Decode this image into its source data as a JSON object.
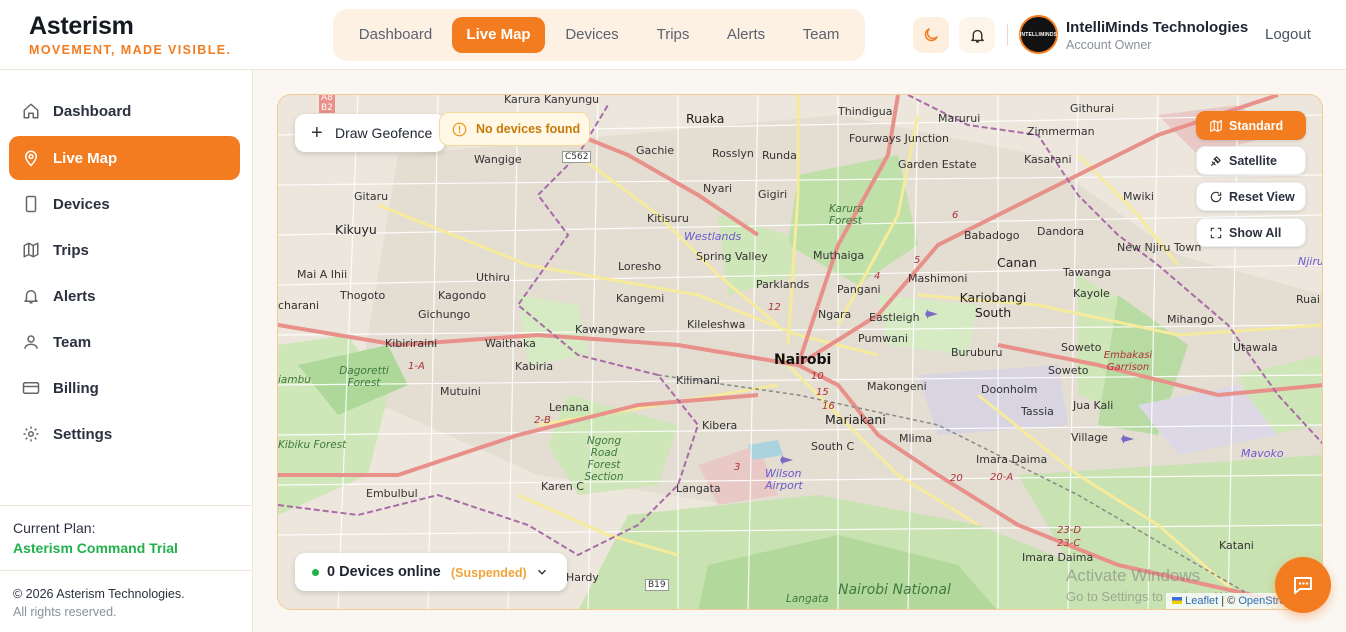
{
  "brand": {
    "name": "Asterism",
    "tagline": "MOVEMENT, MADE VISIBLE."
  },
  "topnav": {
    "tabs": [
      "Dashboard",
      "Live Map",
      "Devices",
      "Trips",
      "Alerts",
      "Team"
    ],
    "active": "Live Map"
  },
  "header": {
    "theme_icon": "moon-icon",
    "notification_icon": "bell-icon",
    "account": {
      "avatar_text": "INTELLIMINDS",
      "name": "IntelliMinds Technologies",
      "role": "Account Owner"
    },
    "logout_label": "Logout"
  },
  "sidebar": {
    "items": [
      {
        "label": "Dashboard",
        "icon": "home-icon"
      },
      {
        "label": "Live Map",
        "icon": "map-pin-icon"
      },
      {
        "label": "Devices",
        "icon": "device-icon"
      },
      {
        "label": "Trips",
        "icon": "map-icon"
      },
      {
        "label": "Alerts",
        "icon": "bell-icon"
      },
      {
        "label": "Team",
        "icon": "users-icon"
      },
      {
        "label": "Billing",
        "icon": "credit-card-icon"
      },
      {
        "label": "Settings",
        "icon": "gear-icon"
      }
    ],
    "active": "Live Map",
    "plan_label": "Current Plan:",
    "plan_value": "Asterism Command Trial",
    "copyright": "© 2026 Asterism Technologies.",
    "rights": "All rights reserved."
  },
  "map": {
    "geofence_label": "Draw Geofence",
    "no_devices": "No devices found",
    "view_buttons": [
      "Standard",
      "Satellite",
      "Reset View",
      "Show All"
    ],
    "active_view": "Standard",
    "devices_online": "0 Devices online",
    "devices_status": "(Suspended)",
    "attribution_leaflet": "Leaflet",
    "attribution_sep": " | © ",
    "attribution_osm": "OpenStreetMap",
    "watermark_line1": "Activate Windows",
    "watermark_line2": "Go to Settings to activate Windows.",
    "place_labels": {
      "ruaka": "Ruaka",
      "karura_kanyungu": "Karura Kanyungu",
      "wangige": "Wangige",
      "gachie": "Gachie",
      "rosslyn": "Rosslyn",
      "runda": "Runda",
      "nyari": "Nyari",
      "gigiri": "Gigiri",
      "thindigua": "Thindigua",
      "fourways": "Fourways Junction",
      "marurui": "Marurui",
      "githurai": "Githurai",
      "zimmerman": "Zimmerman",
      "garden_estate": "Garden Estate",
      "kasarani": "Kasarani",
      "gitaru": "Gitaru",
      "kitisuru": "Kitisuru",
      "karura_forest": "Karura Forest",
      "mwiki": "Mwiki",
      "kikuyu": "Kikuyu",
      "westlands": "Westlands",
      "spring_valley": "Spring Valley",
      "muthaiga": "Muthaiga",
      "babadogo": "Babadogo",
      "dandora": "Dandora",
      "new_njiru": "New Njiru Town",
      "mai_a_ihii": "Mai A Ihii",
      "uthiru": "Uthiru",
      "loresho": "Loresho",
      "mashimoni": "Mashimoni",
      "canan": "Canan",
      "tawanga": "Tawanga",
      "thogoto": "Thogoto",
      "kagondo": "Kagondo",
      "kangemi": "Kangemi",
      "parklands": "Parklands",
      "pangani": "Pangani",
      "kariobangi": "Kariobangi South",
      "kayole": "Kayole",
      "gichungo": "Gichungo",
      "kawangware": "Kawangware",
      "kileleshwa": "Kileleshwa",
      "ngara": "Ngara",
      "eastleigh": "Eastleigh",
      "mihango": "Mihango",
      "kibiriraini": "Kibiriraini",
      "waithaka": "Waithaka",
      "pumwani": "Pumwani",
      "soweto1": "Soweto",
      "utawala": "Utawala",
      "dagoretti": "Dagoretti Forest",
      "kabiria": "Kabiria",
      "nairobi": "Nairobi",
      "buruburu": "Buruburu",
      "embakasi": "Embakasi Garrison",
      "soweto2": "Soweto",
      "kilimani": "Kilimani",
      "makongeni": "Makongeni",
      "doonholm": "Doonholm",
      "mutuini": "Mutuini",
      "lenana": "Lenana",
      "mariakani": "Mariakani",
      "tassia": "Tassia",
      "jua_kali": "Jua Kali",
      "ngong_road": "Ngong Road Forest Section",
      "kibera": "Kibera",
      "south_c": "South C",
      "mlima": "Mlima",
      "village": "Village",
      "imara_daima1": "Imara Daima",
      "kibiku": "Kibiku Forest",
      "wilson": "Wilson Airport",
      "mavoko": "Mavoko",
      "karen_c": "Karen C",
      "langata1": "Langata",
      "embulbul": "Embulbul",
      "imara_daima2": "Imara Daima",
      "katani": "Katani",
      "hardy": "Hardy",
      "langata2": "Langata",
      "nairobi_np": "Nairobi National",
      "charani": "charani",
      "ruai": "Ruai",
      "njiru": "Njiru",
      "iambu": "iambu"
    },
    "road_labels": [
      "C562",
      "B19",
      "A8",
      "B2",
      "1-A",
      "2-B",
      "10",
      "15",
      "16",
      "12",
      "3",
      "4",
      "5",
      "6",
      "20",
      "20-A",
      "23-D",
      "23-C"
    ]
  },
  "chat_icon": "chat-icon",
  "colors": {
    "accent": "#f47c20",
    "success": "#22b04b",
    "warning": "#f0a53a"
  }
}
